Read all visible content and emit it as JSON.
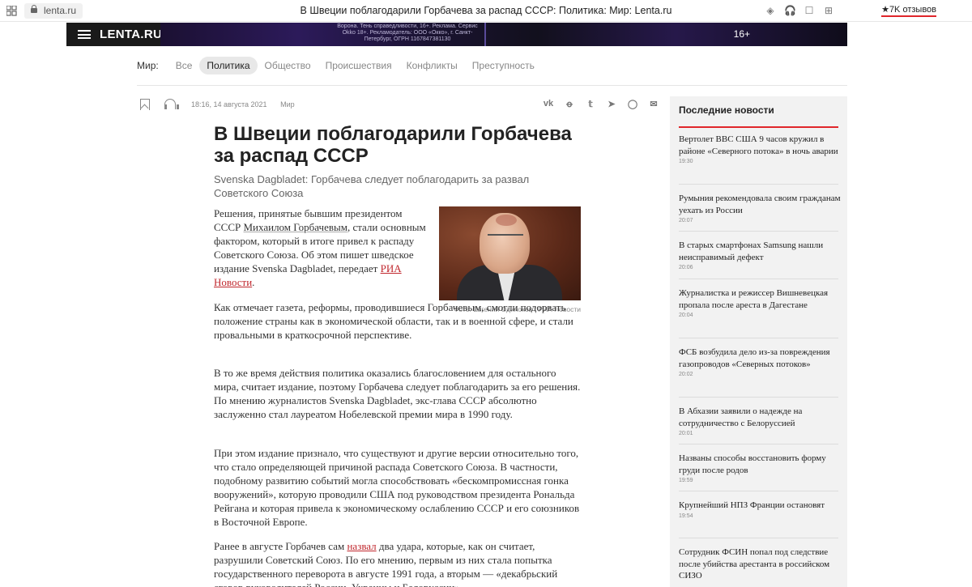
{
  "browser": {
    "url": "lenta.ru",
    "title": "В Швеции поблагодарили Горбачева за распад СССР: Политика: Мир: Lenta.ru",
    "reviews": "★7K отзывов"
  },
  "header": {
    "logo": "LENTA.RU",
    "ad_text": "Ворона. Тень справедливости, 16+. Реклама. Сервис Okko 18+. Рекламодатель: ООО «Окко», г. Санкт-Петербург, ОГРН 1167847381130",
    "age_label": "16+"
  },
  "section_nav": {
    "label": "Мир:",
    "items": [
      {
        "label": "Все",
        "active": false
      },
      {
        "label": "Политика",
        "active": true
      },
      {
        "label": "Общество",
        "active": false
      },
      {
        "label": "Происшествия",
        "active": false
      },
      {
        "label": "Конфликты",
        "active": false
      },
      {
        "label": "Преступность",
        "active": false
      }
    ]
  },
  "article": {
    "datetime": "18:16, 14 августа 2021",
    "rubric": "Мир",
    "share": [
      "vk",
      "ok",
      "twitter",
      "telegram",
      "whatsapp",
      "email"
    ],
    "title": "В Швеции поблагодарили Горбачева за распад СССР",
    "lead": "Svenska Dagbladet: Горбачева следует поблагодарить за развал Советского Союза",
    "photo_caption": "Фото: Евгений Одиноков / РИА Новости",
    "p1_a": "Решения, принятые бывшим президентом СССР ",
    "p1_link1": "Михаилом Горбачевым",
    "p1_b": ", стали основным фактором, который в итоге привел к распаду Советского Союза. Об этом пишет шведское издание Svenska Dagbladet, передает ",
    "p1_link2": "РИА Новости",
    "p1_c": ".",
    "p2": "Как отмечает газета, реформы, проводившиеся Горбачевым, смогли подорвать положение страны как в экономической области, так и в военной сфере, и стали провальными в краткосрочной перспективе.",
    "p3": "В то же время действия политика оказались благословением для остального мира, считает издание, поэтому Горбачева следует поблагодарить за его решения. По мнению журналистов Svenska Dagbladet, экс-глава СССР абсолютно заслуженно стал лауреатом Нобелевской премии мира в 1990 году.",
    "p4": "При этом издание признало, что существуют и другие версии относительно того, что стало определяющей причиной распада Советского Союза. В частности, подобному развитию событий могла способствовать «бескомпромиссная гонка вооружений», которую проводили США под руководством президента Рональда Рейгана и которая привела к экономическому ослаблению СССР и его союзников в Восточной Европе.",
    "p5_a": "Ранее в августе Горбачев сам ",
    "p5_link": "назвал",
    "p5_b": " два удара, которые, как он считает, разрушили Советский Союз. По его мнению, первым из них стала попытка государственного переворота в августе 1991 года, а вторым — «декабрьский сговор руководителей России, Украины и Белоруссии»."
  },
  "sidebar": {
    "title": "Последние новости",
    "items": [
      {
        "title": "Вертолет ВВС США 9 часов кружил в районе «Северного потока» в ночь аварии",
        "time": "19:30"
      },
      {
        "title": "Румыния рекомендовала своим гражданам уехать из России",
        "time": "20:07"
      },
      {
        "title": "В старых смартфонах Samsung нашли неисправимый дефект",
        "time": "20:06"
      },
      {
        "title": "Журналистка и режиссер Вишневецкая пропала после ареста в Дагестане",
        "time": "20:04"
      },
      {
        "title": "ФСБ возбудила дело из-за повреждения газопроводов «Северных потоков»",
        "time": "20:02"
      },
      {
        "title": "В Абхазии заявили о надежде на сотрудничество с Белоруссией",
        "time": "20:01"
      },
      {
        "title": "Названы способы восстановить форму груди после родов",
        "time": "19:59"
      },
      {
        "title": "Крупнейший НПЗ Франции остановят",
        "time": "19:54"
      },
      {
        "title": "Сотрудник ФСИН попал под следствие после убийства арестанта в российском СИЗО",
        "time": ""
      }
    ]
  }
}
